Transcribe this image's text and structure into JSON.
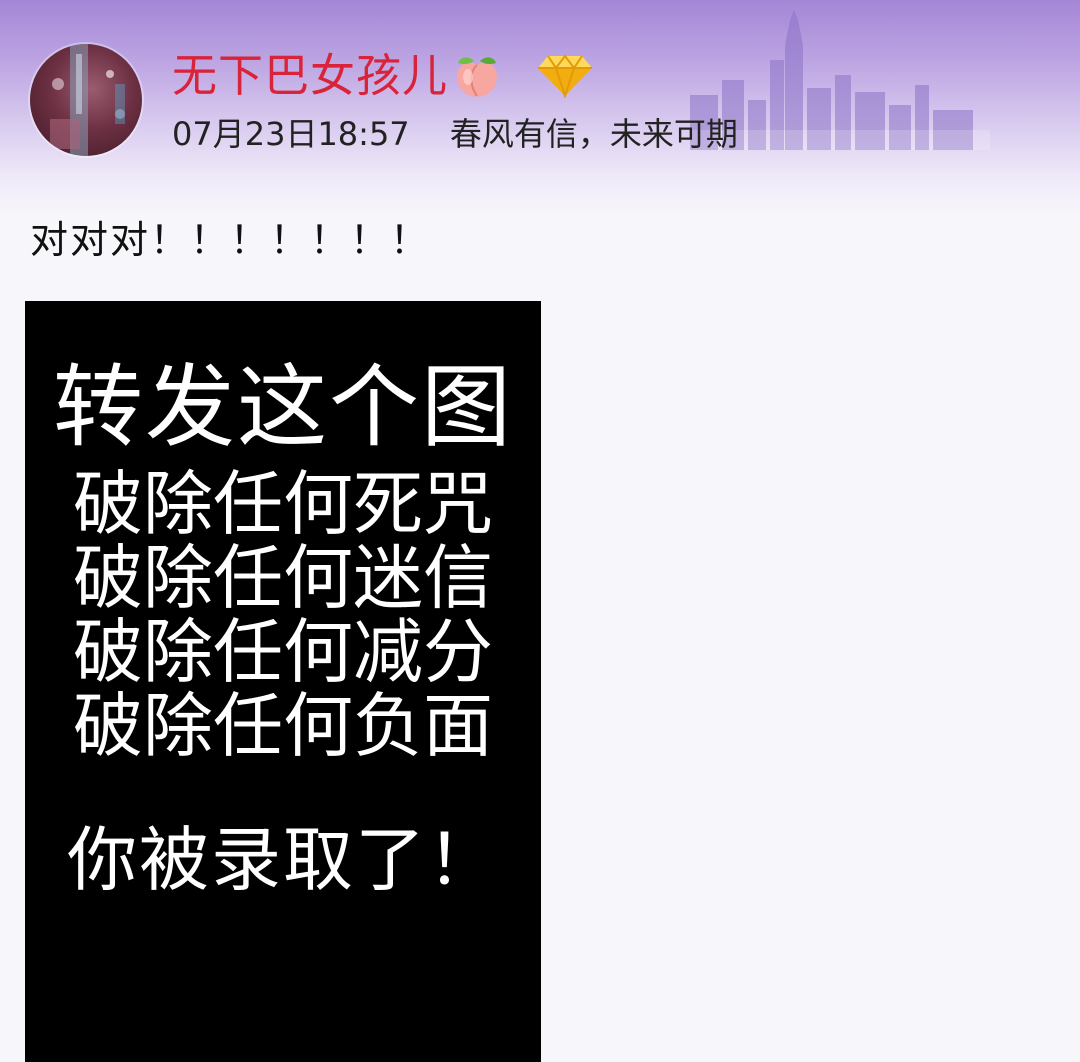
{
  "post": {
    "author": {
      "name": "无下巴女孩儿",
      "emoji_icon": "peach-icon",
      "badge_icon": "diamond-icon"
    },
    "timestamp": "07月23日18:57",
    "signature": "春风有信，未来可期",
    "text": "对对对！！！！！！！",
    "image": {
      "headline": "转发这个图",
      "lines": [
        "破除任何死咒",
        "破除任何迷信",
        "破除任何减分",
        "破除任何负面"
      ],
      "footer": "你被录取了！"
    }
  },
  "colors": {
    "username": "#d8233a",
    "header_top": "#a486d6",
    "image_bg": "#000000",
    "page_bg": "#f6f6fb"
  }
}
